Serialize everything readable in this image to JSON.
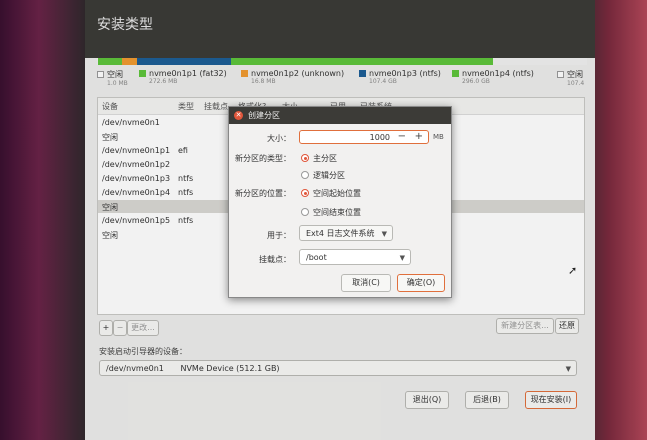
{
  "window": {
    "title": "安装类型"
  },
  "partition_bar": [
    {
      "color": "#f0f0f0",
      "flex": 1
    },
    {
      "color": "#5ec43c",
      "flex": 27
    },
    {
      "color": "#f09a31",
      "flex": 17
    },
    {
      "color": "#1d5e96",
      "flex": 107
    },
    {
      "color": "#5ec43c",
      "flex": 296
    },
    {
      "color": "#f0f0f0",
      "flex": 107
    }
  ],
  "legend": [
    {
      "name": "空闲",
      "size": "1.0 MB",
      "color": "#ffffff"
    },
    {
      "name": "nvme0n1p1 (fat32)",
      "size": "272.6 MB",
      "color": "#5ec43c"
    },
    {
      "name": "nvme0n1p2 (unknown)",
      "size": "16.8 MB",
      "color": "#f09a31"
    },
    {
      "name": "nvme0n1p3 (ntfs)",
      "size": "107.4 GB",
      "color": "#1d5e96"
    },
    {
      "name": "nvme0n1p4 (ntfs)",
      "size": "296.0 GB",
      "color": "#5ec43c"
    },
    {
      "name": "空闲",
      "size": "107.4",
      "color": "#ffffff"
    }
  ],
  "table": {
    "headers": [
      "设备",
      "类型",
      "挂载点",
      "格式化?",
      "大小",
      "已用",
      "已装系统"
    ],
    "rows": [
      {
        "device": "/dev/nvme0n1",
        "type": "",
        "selected": false
      },
      {
        "device": "空闲",
        "type": "",
        "selected": false
      },
      {
        "device": "/dev/nvme0n1p1",
        "type": "efi",
        "selected": false
      },
      {
        "device": "/dev/nvme0n1p2",
        "type": "",
        "selected": false
      },
      {
        "device": "/dev/nvme0n1p3",
        "type": "ntfs",
        "selected": false
      },
      {
        "device": "/dev/nvme0n1p4",
        "type": "ntfs",
        "selected": false
      },
      {
        "device": "空闲",
        "type": "",
        "selected": true
      },
      {
        "device": "/dev/nvme0n1p5",
        "type": "ntfs",
        "selected": false
      },
      {
        "device": "空闲",
        "type": "",
        "selected": false
      }
    ],
    "partial_right_text": "er"
  },
  "table_buttons": {
    "add": "+",
    "remove": "−",
    "change": "更改...",
    "new_table": "新建分区表...",
    "revert": "还原"
  },
  "bootloader": {
    "label": "安装启动引导器的设备：",
    "device": "/dev/nvme0n1",
    "description": "NVMe Device (512.1 GB)"
  },
  "footer": {
    "quit": "退出(Q)",
    "back": "后退(B)",
    "install_now": "现在安装(I)"
  },
  "dialog": {
    "title": "创建分区",
    "size_label": "大小：",
    "size_value": "1000",
    "size_minus": "−",
    "size_plus": "+",
    "size_unit": "MB",
    "type_label": "新分区的类型：",
    "type_primary": "主分区",
    "type_logical": "逻辑分区",
    "location_label": "新分区的位置：",
    "location_start": "空间起始位置",
    "location_end": "空间结束位置",
    "use_label": "用于：",
    "use_value": "Ext4 日志文件系统",
    "mount_label": "挂载点：",
    "mount_value": "/boot",
    "cancel": "取消(C)",
    "ok": "确定(O)"
  }
}
